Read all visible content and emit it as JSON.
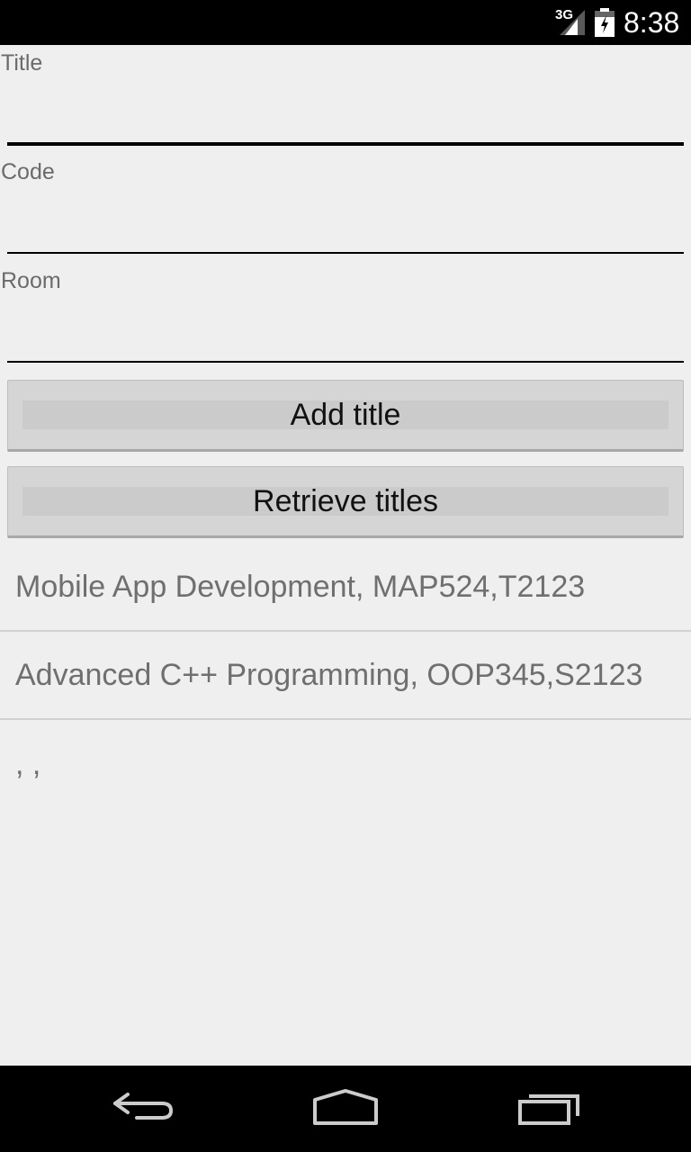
{
  "status_bar": {
    "network_label": "3G",
    "time": "8:38",
    "icons": [
      "signal-icon",
      "battery-icon"
    ]
  },
  "form": {
    "title_label": "Title",
    "title_value": "",
    "code_label": "Code",
    "code_value": "",
    "room_label": "Room",
    "room_value": ""
  },
  "buttons": {
    "add_label": "Add title",
    "retrieve_label": "Retrieve titles"
  },
  "list": {
    "items": [
      "Mobile App Development, MAP524,T2123",
      "Advanced C++ Programming, OOP345,S2123",
      ", ,"
    ]
  },
  "nav_bar": {
    "icons": [
      "back-icon",
      "home-icon",
      "recent-apps-icon"
    ]
  }
}
